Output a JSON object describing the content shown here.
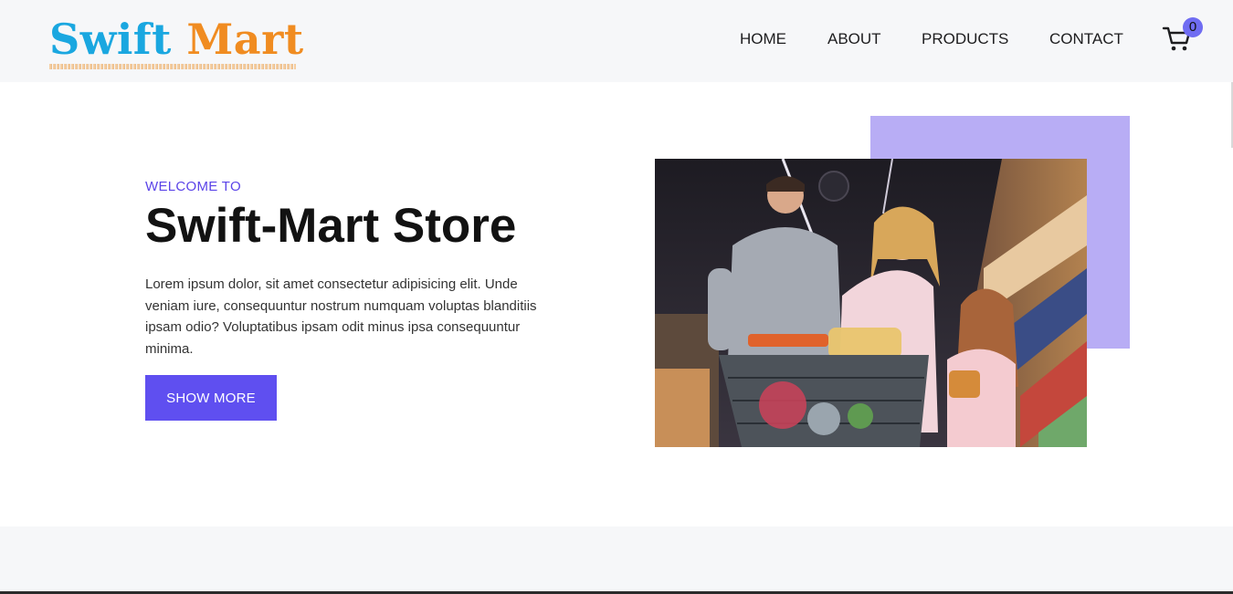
{
  "brand": {
    "part1": "Swift",
    "part2": "Mart",
    "color_part1": "#1aa7e0",
    "color_part2": "#f08c21"
  },
  "nav": {
    "items": [
      {
        "label": "HOME"
      },
      {
        "label": "ABOUT"
      },
      {
        "label": "PRODUCTS"
      },
      {
        "label": "CONTACT"
      }
    ]
  },
  "cart": {
    "icon": "shopping-cart-icon",
    "count": "0",
    "badge_color": "#6f6cf2"
  },
  "hero": {
    "eyebrow": "WELCOME TO",
    "title": "Swift-Mart Store",
    "text": "Lorem ipsum dolor, sit amet consectetur adipisicing elit. Unde veniam iure, consequuntur nostrum numquam voluptas blanditiis ipsam odio? Voluptatibus ipsam odit minus ipsa consequuntur minima.",
    "button_label": "SHOW MORE",
    "accent_color": "#5f4ff0",
    "photo_backdrop_color": "#b8adf5"
  }
}
